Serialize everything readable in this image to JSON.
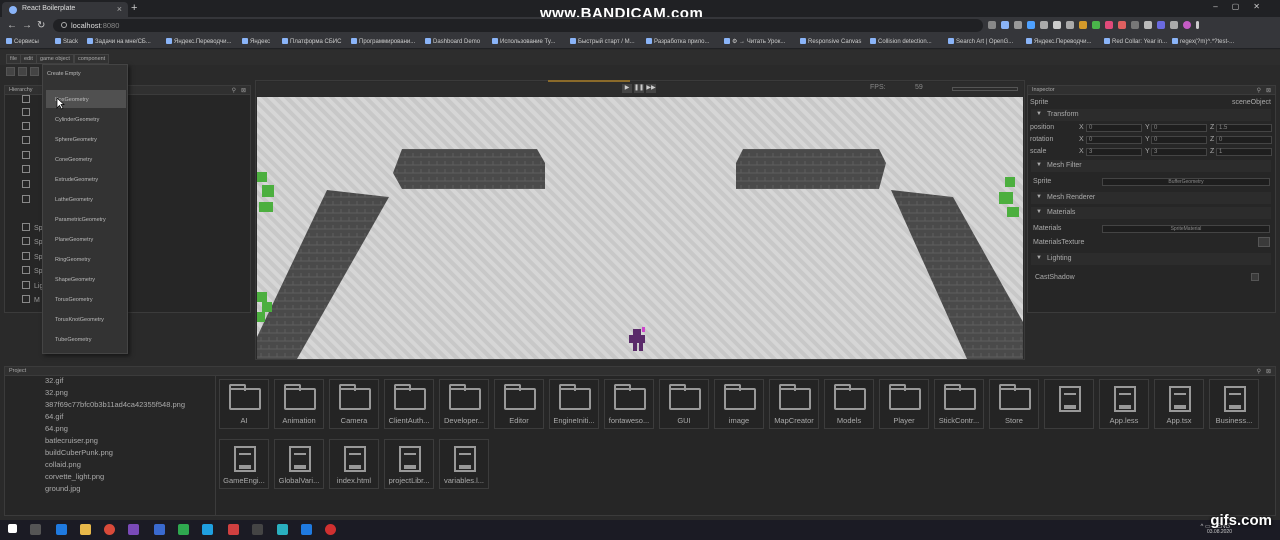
{
  "browser": {
    "tab_title": "React Boilerplate",
    "url_host": "localhost",
    "url_port": ":8080",
    "watermark": "www.BANDICAM.com",
    "bookmarks": [
      "Сервисы",
      "Stack",
      "Задачи на мне/СБ...",
      "Яндекс.Переводчи...",
      "Яндекс",
      "Платформа СБИС",
      "Программировани...",
      "Dashboard Demo",
      "Использование Ty...",
      "Быстрый старт / М...",
      "Разработка прило...",
      "⚙ → Читать Урок...",
      "Responsive Canvas",
      "Collision detection...",
      "Search Art | OpenG...",
      "Яндекс.Переводчи...",
      "Red Collar: Year in...",
      "regex(?m)^.*?test-..."
    ]
  },
  "editor": {
    "menus": [
      "file",
      "edit",
      "game object",
      "component"
    ],
    "create_menu": {
      "title": "Create Empty",
      "items": [
        "BoxGeometry",
        "CylinderGeometry",
        "SphereGeometry",
        "ConeGeometry",
        "ExtrudeGeometry",
        "LatheGeometry",
        "ParametricGeometry",
        "PlaneGeometry",
        "RingGeometry",
        "ShapeGeometry",
        "TorusGeometry",
        "TorusKnotGeometry",
        "TubeGeometry"
      ]
    },
    "hierarchy": {
      "title": "Hierarchy",
      "rows": [
        "",
        "",
        "",
        "",
        "",
        "",
        "",
        "",
        "Sp",
        "Sp",
        "Sp",
        "Sp",
        "Lig",
        "M"
      ]
    },
    "scene": {
      "fps_label": "FPS:",
      "fps_value": "59"
    },
    "inspector": {
      "title": "Inspector",
      "object_type": "Sprite",
      "object_name": "sceneObject",
      "sections": {
        "transform": "Transform",
        "mesh_filter": "Mesh Filter",
        "mesh_renderer": "Mesh Renderer",
        "materials": "Materials",
        "lighting": "Lighting"
      },
      "position": {
        "label": "position",
        "x": "0",
        "y": "0",
        "z": "1.5"
      },
      "rotation": {
        "label": "rotation",
        "x": "0",
        "y": "0",
        "z": "0"
      },
      "scale": {
        "label": "scale",
        "x": "3",
        "y": "3",
        "z": "1"
      },
      "mesh_filter_label": "Sprite",
      "mesh_filter_value": "BufferGeometry",
      "materials_label": "Materials",
      "materials_value": "SpriteMaterial",
      "materials_texture_label": "MaterialsTexture",
      "cast_shadow_label": "CastShadow",
      "axis_x": "X",
      "axis_y": "Y",
      "axis_z": "Z"
    },
    "project": {
      "title": "Project",
      "files": [
        "32.gif",
        "32.png",
        "387f69c77bfc0b3b11ad4ca42355f548.png",
        "64.gif",
        "64.png",
        "batlecruiser.png",
        "buildCuberPunk.png",
        "collaid.png",
        "corvette_light.png",
        "ground.jpg"
      ],
      "folders": [
        "AI",
        "Animation",
        "Camera",
        "ClientAuth...",
        "Developer...",
        "Editor",
        "EngineIniti...",
        "fontaweso...",
        "GUI",
        "image",
        "MapCreator",
        "Models",
        "Player",
        "StickContr...",
        "Store"
      ],
      "docs_row1": [
        "",
        "App.less",
        "App.tsx",
        "Business..."
      ],
      "docs_row2": [
        "GameEngi...",
        "GlobalVari...",
        "index.html",
        "projectLibr...",
        "variables.l..."
      ]
    }
  },
  "taskbar": {
    "time": "",
    "date": "03.08.2020",
    "gifs_watermark": "gifs.com"
  }
}
